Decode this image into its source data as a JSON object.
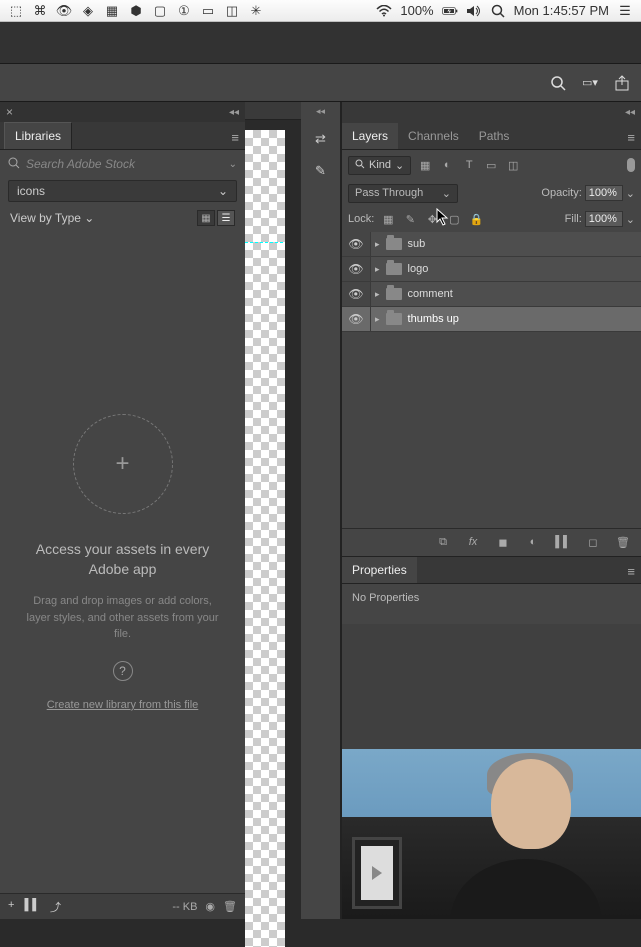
{
  "menubar": {
    "battery_pct": "100%",
    "clock": "Mon 1:45:57 PM"
  },
  "libraries": {
    "tab_label": "Libraries",
    "search_placeholder": "Search Adobe Stock",
    "dropdown_value": "icons",
    "view_label": "View by Type",
    "empty_title": "Access your assets in every Adobe app",
    "empty_sub": "Drag and drop images or add colors, layer styles, and other assets from your file.",
    "create_link": "Create new library from this file",
    "footer_size": "-- KB"
  },
  "layers_panel": {
    "tabs": [
      "Layers",
      "Channels",
      "Paths"
    ],
    "active_tab": 0,
    "filter_label": "Kind",
    "blend_mode": "Pass Through",
    "opacity_label": "Opacity:",
    "opacity_value": "100%",
    "lock_label": "Lock:",
    "fill_label": "Fill:",
    "fill_value": "100%",
    "layers": [
      {
        "name": "sub"
      },
      {
        "name": "logo"
      },
      {
        "name": "comment"
      },
      {
        "name": "thumbs up"
      }
    ],
    "selected_index": 3
  },
  "properties": {
    "tab_label": "Properties",
    "body_text": "No Properties"
  }
}
